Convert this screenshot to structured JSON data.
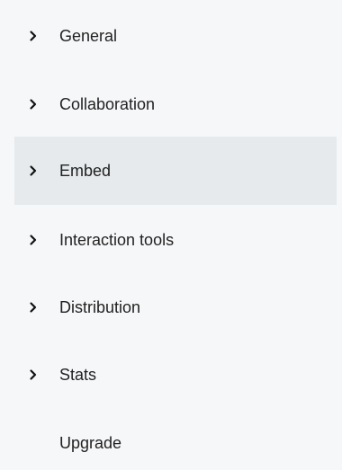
{
  "sidebar": {
    "items": [
      {
        "label": "General",
        "icon": "chevron-right-icon",
        "expandable": true,
        "active": false
      },
      {
        "label": "Collaboration",
        "icon": "chevron-right-icon",
        "expandable": true,
        "active": false
      },
      {
        "label": "Embed",
        "icon": "chevron-right-icon",
        "expandable": true,
        "active": true
      },
      {
        "label": "Interaction tools",
        "icon": "chevron-right-icon",
        "expandable": true,
        "active": false
      },
      {
        "label": "Distribution",
        "icon": "chevron-right-icon",
        "expandable": true,
        "active": false
      },
      {
        "label": "Stats",
        "icon": "chevron-right-icon",
        "expandable": true,
        "active": false
      },
      {
        "label": "Upgrade",
        "expandable": false,
        "active": false
      }
    ]
  },
  "colors": {
    "background": "#f6f7f9",
    "active_background": "#e6eaec",
    "text": "#222222"
  }
}
